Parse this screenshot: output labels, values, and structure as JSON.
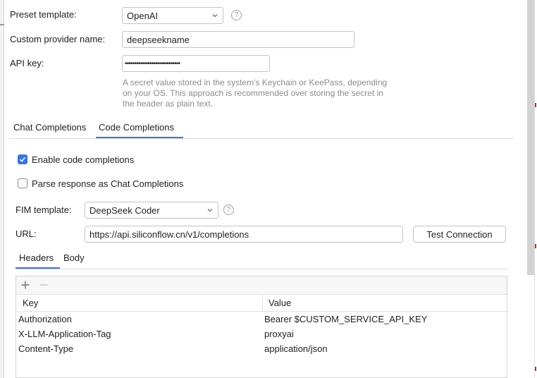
{
  "form": {
    "preset_label": "Preset template:",
    "preset_value": "OpenAI",
    "provider_label": "Custom provider name:",
    "provider_value": "deepseekname",
    "apikey_label": "API key:",
    "apikey_value": "•••••••••••••••••••••••••••••",
    "apikey_hint": [
      "A secret value stored in the system's Keychain or KeePass, depending",
      "on your OS. This approach is recommended over storing the secret in",
      "the header as plain text."
    ]
  },
  "tabs": [
    {
      "label": "Chat Completions",
      "active": false
    },
    {
      "label": "Code Completions",
      "active": true
    }
  ],
  "code": {
    "enable_label": "Enable code completions",
    "enable_checked": true,
    "parse_label": "Parse response as Chat Completions",
    "parse_checked": false,
    "fim_label": "FIM template:",
    "fim_value": "DeepSeek Coder",
    "url_label": "URL:",
    "url_value": "https://api.siliconflow.cn/v1/completions",
    "test_button": "Test Connection"
  },
  "subtabs": [
    {
      "label": "Headers",
      "active": true
    },
    {
      "label": "Body",
      "active": false
    }
  ],
  "headers_table": {
    "columns": [
      "Key",
      "Value"
    ],
    "rows": [
      {
        "key": "Authorization",
        "value": "Bearer $CUSTOM_SERVICE_API_KEY"
      },
      {
        "key": "X-LLM-Application-Tag",
        "value": "proxyai"
      },
      {
        "key": "Content-Type",
        "value": "application/json"
      }
    ]
  },
  "icons": {
    "help": "question-circle-icon",
    "add": "plus-icon",
    "remove": "minus-icon",
    "dropdown": "chevron-down-icon",
    "check": "check-icon"
  },
  "colors": {
    "accent": "#3574f0",
    "hint_text": "#8c8c8c",
    "border": "#c4c4c4"
  }
}
